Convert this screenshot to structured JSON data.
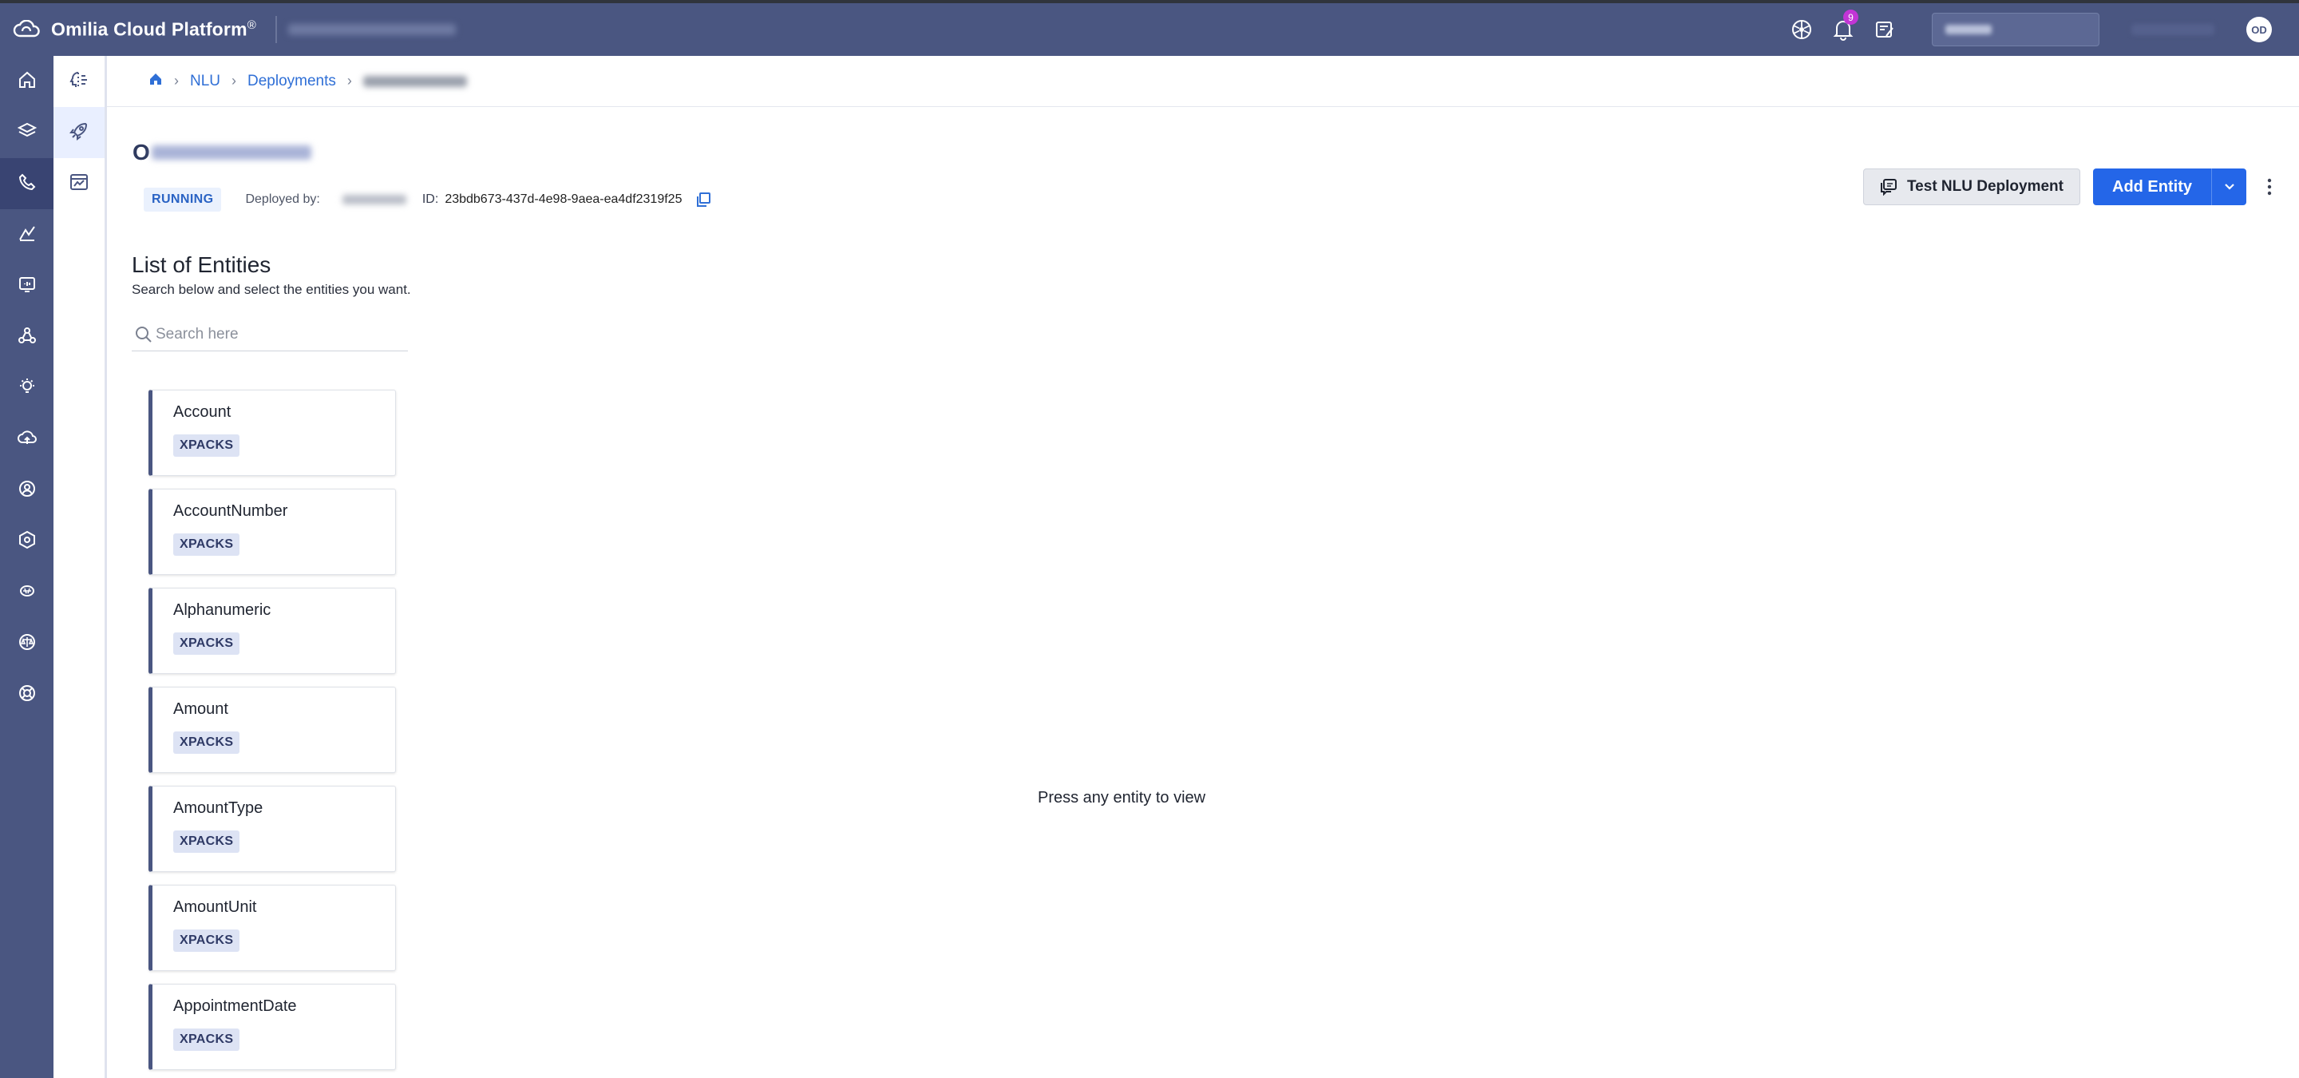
{
  "app": {
    "name": "Omilia Cloud Platform",
    "trademark": "®",
    "notification_count": "9",
    "user_initials": "OD"
  },
  "breadcrumb": {
    "items": [
      "NLU",
      "Deployments"
    ]
  },
  "deployment": {
    "title_initial": "O",
    "status": "RUNNING",
    "deployed_by_label": "Deployed by:",
    "id_label": "ID:",
    "id": "23bdb673-437d-4e98-9aea-ea4df2319f25"
  },
  "actions": {
    "test_label": "Test NLU Deployment",
    "add_label": "Add Entity"
  },
  "entities": {
    "title": "List of Entities",
    "subtitle": "Search below and select the entities you want.",
    "search_placeholder": "Search here",
    "items": [
      {
        "name": "Account",
        "tag": "XPACKS"
      },
      {
        "name": "AccountNumber",
        "tag": "XPACKS"
      },
      {
        "name": "Alphanumeric",
        "tag": "XPACKS"
      },
      {
        "name": "Amount",
        "tag": "XPACKS"
      },
      {
        "name": "AmountType",
        "tag": "XPACKS"
      },
      {
        "name": "AmountUnit",
        "tag": "XPACKS"
      },
      {
        "name": "AppointmentDate",
        "tag": "XPACKS"
      }
    ]
  },
  "detail": {
    "empty_message": "Press any entity to view"
  },
  "colors": {
    "primary_nav": "#4a5681",
    "accent_blue": "#2466e8",
    "link_blue": "#2f6fd6",
    "badge_purple": "#c235d6"
  }
}
